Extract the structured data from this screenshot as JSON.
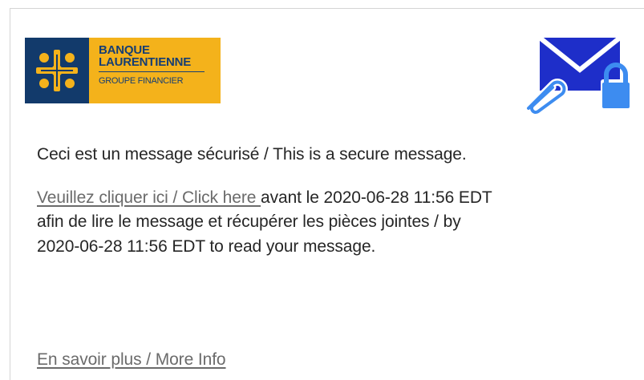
{
  "brand": {
    "name_line1": "BANQUE",
    "name_line2": "LAURENTIENNE",
    "tagline": "GROUPE FINANCIER",
    "icon": "stylized-leaf-logo",
    "colors": {
      "logo_blue": "#123a6b",
      "logo_gold": "#f4b21b"
    }
  },
  "secure_icon": {
    "name": "envelope-lock-attachment-icon",
    "colors": {
      "envelope": "#1e2ec9",
      "lock": "#3d8cf0"
    }
  },
  "message": {
    "intro": "Ceci est un message sécurisé / This is a secure message.",
    "link_text": "Veuillez cliquer ici / Click here ",
    "line1_rest": "avant le 2020-06-28 11:56 EDT",
    "line2": "afin de lire le message et récupérer les pièces jointes / by",
    "line3": "2020-06-28 11:56 EDT to read your message."
  },
  "footer": {
    "more_info_link": "En savoir plus / More Info"
  }
}
